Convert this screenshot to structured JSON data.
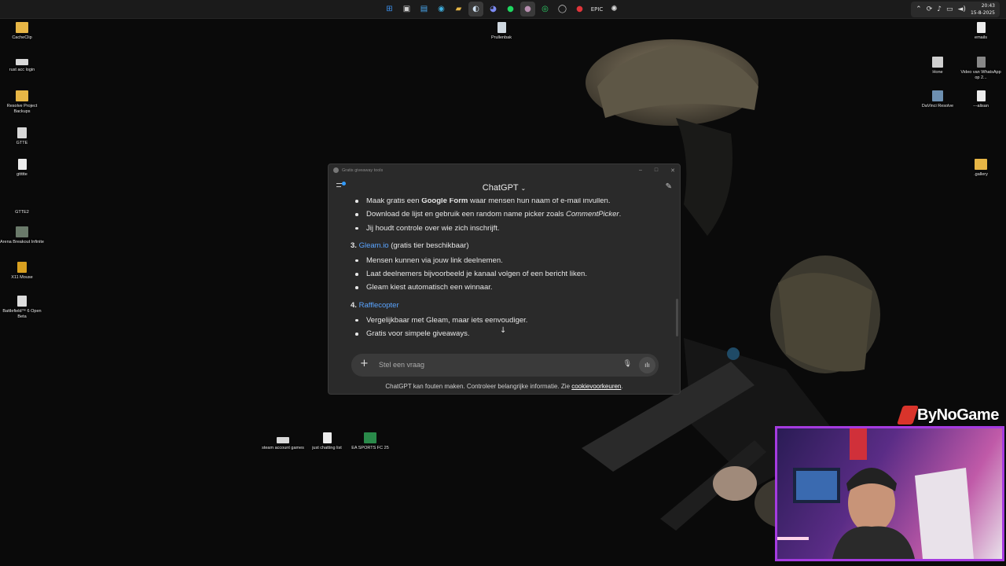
{
  "taskbar": {
    "icons": [
      "windows-start",
      "task-view",
      "store",
      "edge",
      "file-explorer",
      "steam",
      "discord",
      "spotify",
      "avatar",
      "whatsapp",
      "opera-gx",
      "opera",
      "epic-games",
      "chatgpt"
    ],
    "clock_time": "20:43",
    "clock_date": "15-8-2025"
  },
  "desktop_left": [
    {
      "label": "CacheClip",
      "icon": "folder"
    },
    {
      "label": "rust acc login",
      "icon": "app"
    },
    {
      "label": "Resolve Project Backups",
      "icon": "folder"
    },
    {
      "label": "GTTE",
      "icon": "app"
    },
    {
      "label": "gttttte",
      "icon": "file"
    },
    {
      "label": "GTTE2",
      "icon": "app"
    },
    {
      "label": "Arena Breakout Infinite",
      "icon": "app"
    },
    {
      "label": "X11 Mouse",
      "icon": "app"
    },
    {
      "label": "Battlefield™ 6 Open Beta",
      "icon": "app"
    }
  ],
  "desktop_right": [
    {
      "label": "emails",
      "icon": "file"
    },
    {
      "label": "Hone",
      "icon": "app"
    },
    {
      "label": "Video van WhatsApp op 2...",
      "icon": "file"
    },
    {
      "label": "DaVinci Resolve",
      "icon": "app"
    },
    {
      "label": "---alisan",
      "icon": "file"
    },
    {
      "label": ".gallery",
      "icon": "folder"
    }
  ],
  "desktop_center": [
    {
      "label": "Prullenbak",
      "icon": "recycle-bin"
    },
    {
      "label": "steam account games",
      "icon": "app"
    },
    {
      "label": "just chatting list",
      "icon": "file"
    },
    {
      "label": "EA SPORTS FC 25",
      "icon": "app"
    }
  ],
  "window": {
    "title": "Gratis giveaway tools",
    "brand": "ChatGPT",
    "chat": {
      "cut_line_prefix": "Maak gratis een ",
      "cut_line_bold": "Google Form",
      "cut_line_suffix": " waar mensen hun naam of e-mail invullen.",
      "bullets_a": [
        {
          "prefix": "Download de lijst en gebruik een random name picker zoals ",
          "em": "CommentPicker",
          "suffix": "."
        },
        {
          "prefix": "Jij houdt controle over wie zich inschrijft.",
          "em": "",
          "suffix": ""
        }
      ],
      "section3_num": "3.",
      "section3_link": "Gleam.io",
      "section3_note": " (gratis tier beschikbaar)",
      "bullets_b": [
        "Mensen kunnen via jouw link deelnemen.",
        "Laat deelnemers bijvoorbeeld je kanaal volgen of een bericht liken.",
        "Gleam kiest automatisch een winnaar."
      ],
      "section4_num": "4.",
      "section4_link": "Rafflecopter",
      "bullets_c": [
        "Vergelijkbaar met Gleam, maar iets eenvoudiger.",
        "Gratis voor simpele giveaways."
      ]
    },
    "input_placeholder": "Stel een vraag",
    "disclaimer_text": "ChatGPT kan fouten maken. Controleer belangrijke informatie. Zie ",
    "disclaimer_link": "cookievoorkeuren",
    "disclaimer_end": "."
  },
  "overlay": {
    "logo_text": "ByNoGame"
  }
}
